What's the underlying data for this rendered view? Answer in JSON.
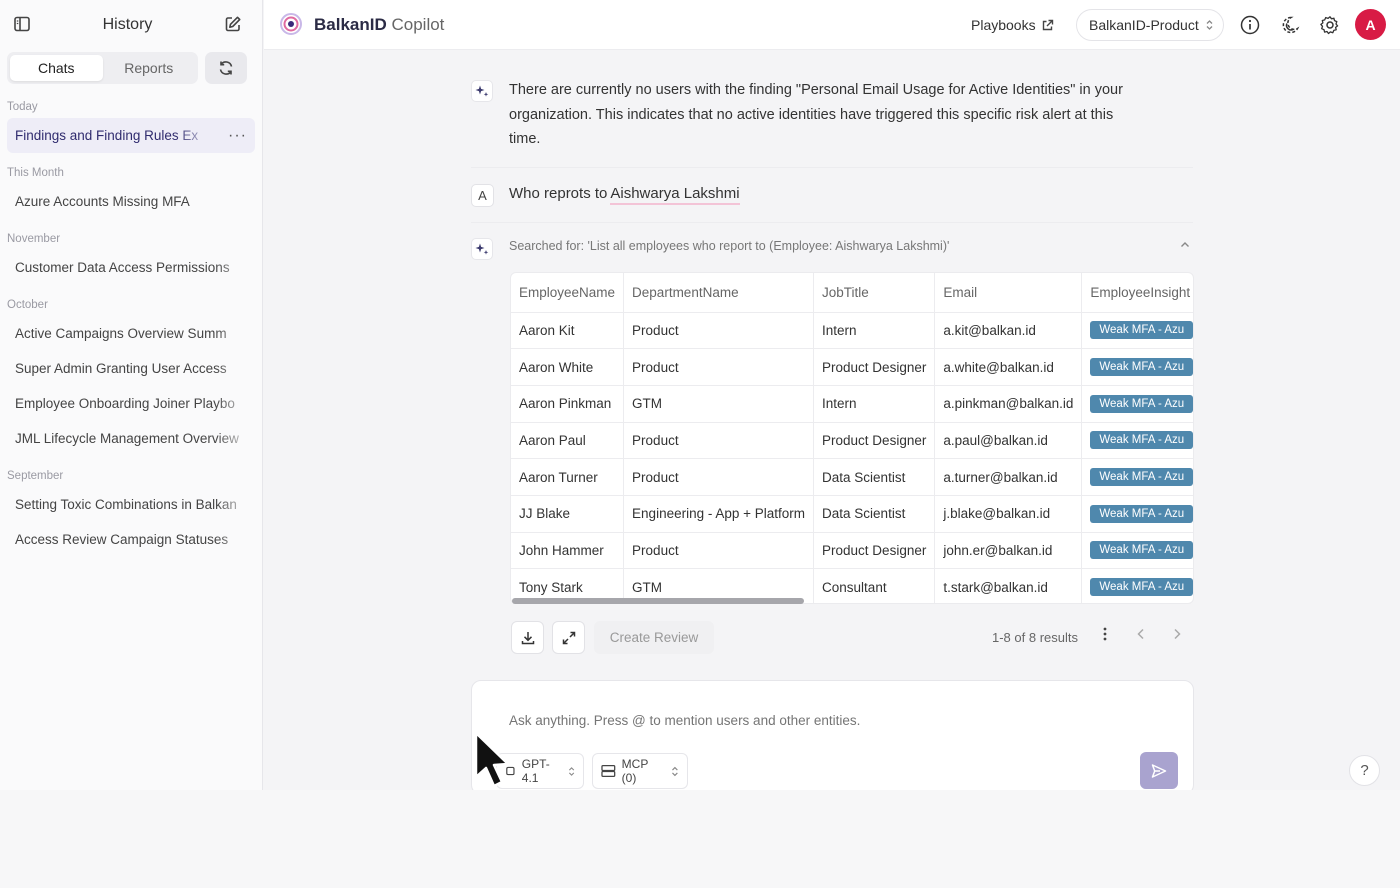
{
  "sidebar": {
    "title": "History",
    "tabs": [
      {
        "label": "Chats",
        "active": true
      },
      {
        "label": "Reports",
        "active": false
      }
    ],
    "groups": [
      {
        "label": "Today",
        "items": [
          "Findings and Finding Rules Ex"
        ]
      },
      {
        "label": "This Month",
        "items": [
          "Azure Accounts Missing MFA"
        ]
      },
      {
        "label": "November",
        "items": [
          "Customer Data Access Permissions"
        ]
      },
      {
        "label": "October",
        "items": [
          "Active Campaigns Overview Summ",
          "Super Admin Granting User Access",
          "Employee Onboarding Joiner Playbo",
          "JML Lifecycle Management Overview"
        ]
      },
      {
        "label": "September",
        "items": [
          "Setting Toxic Combinations in Balkan",
          "Access Review Campaign Statuses"
        ]
      }
    ],
    "more_glyph": "···"
  },
  "header": {
    "app_name_bold": "BalkanID",
    "app_name_light": "Copilot",
    "playbooks_label": "Playbooks",
    "tenant_label": "BalkanID-Product",
    "avatar_initial": "A"
  },
  "conversation": {
    "answer_text": "There are currently no users with the finding \"Personal Email Usage for Active Identities\" in your organization. This indicates that no active identities have triggered this specific risk alert at this time.",
    "user_initial": "A",
    "user_message_prefix": "Who reprots to",
    "user_message_mention": "Aishwarya Lakshmi",
    "searched_for": "Searched for: 'List all employees who report to (Employee: Aishwarya Lakshmi)'"
  },
  "table": {
    "columns": [
      "EmployeeName",
      "DepartmentName",
      "JobTitle",
      "Email",
      "EmployeeInsight"
    ],
    "rows": [
      [
        "Aaron Kit",
        "Product",
        "Intern",
        "a.kit@balkan.id",
        "Weak MFA - Azu"
      ],
      [
        "Aaron White",
        "Product",
        "Product Designer",
        "a.white@balkan.id",
        "Weak MFA - Azu"
      ],
      [
        "Aaron Pinkman",
        "GTM",
        "Intern",
        "a.pinkman@balkan.id",
        "Weak MFA - Azu"
      ],
      [
        "Aaron Paul",
        "Product",
        "Product Designer",
        "a.paul@balkan.id",
        "Weak MFA - Azu"
      ],
      [
        "Aaron Turner",
        "Product",
        "Data Scientist",
        "a.turner@balkan.id",
        "Weak MFA - Azu"
      ],
      [
        "JJ Blake",
        "Engineering - App + Platform",
        "Data Scientist",
        "j.blake@balkan.id",
        "Weak MFA - Azu"
      ],
      [
        "John Hammer",
        "Product",
        "Product Designer",
        "john.er@balkan.id",
        "Weak MFA - Azu"
      ],
      [
        "Tony Stark",
        "GTM",
        "Consultant",
        "t.stark@balkan.id",
        "Weak MFA - Azu"
      ]
    ],
    "create_review_label": "Create Review",
    "results_text": "1-8 of 8 results"
  },
  "composer": {
    "placeholder": "Ask anything. Press @ to mention users and other entities.",
    "model_label": "GPT-4.1",
    "mcp_label": "MCP (0)"
  },
  "help_label": "?",
  "colors": {
    "accent": "#2f2b6e",
    "badge": "#4f88ad",
    "send": "#a9a3cf",
    "avatar": "#d81b45",
    "mention_underline": "#f3c4d7"
  }
}
